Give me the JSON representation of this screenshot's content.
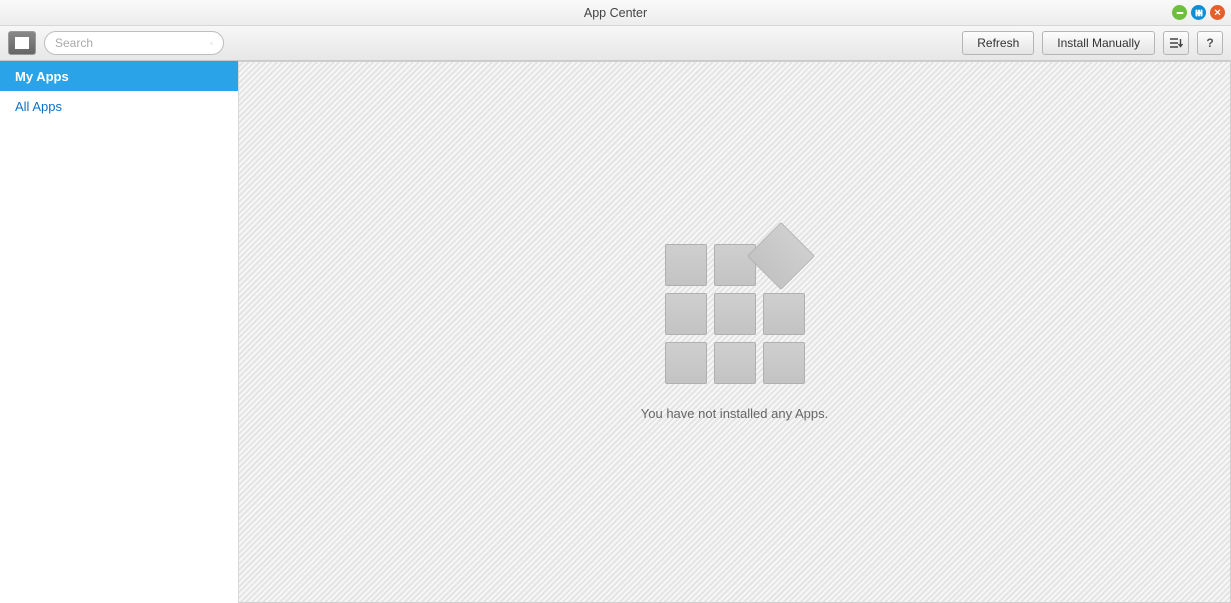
{
  "window": {
    "title": "App Center"
  },
  "toolbar": {
    "search_placeholder": "Search",
    "refresh_label": "Refresh",
    "install_label": "Install Manually",
    "help_label": "?"
  },
  "sidebar": {
    "items": [
      {
        "label": "My Apps",
        "selected": true
      },
      {
        "label": "All Apps",
        "selected": false
      }
    ]
  },
  "main": {
    "empty_message": "You have not installed any Apps."
  },
  "icons": {
    "sidebar_toggle": "panel-icon",
    "search": "search-icon",
    "sort": "sort-icon",
    "help": "help-icon",
    "minimize": "minimize-icon",
    "maximize": "maximize-icon",
    "close": "close-icon"
  }
}
